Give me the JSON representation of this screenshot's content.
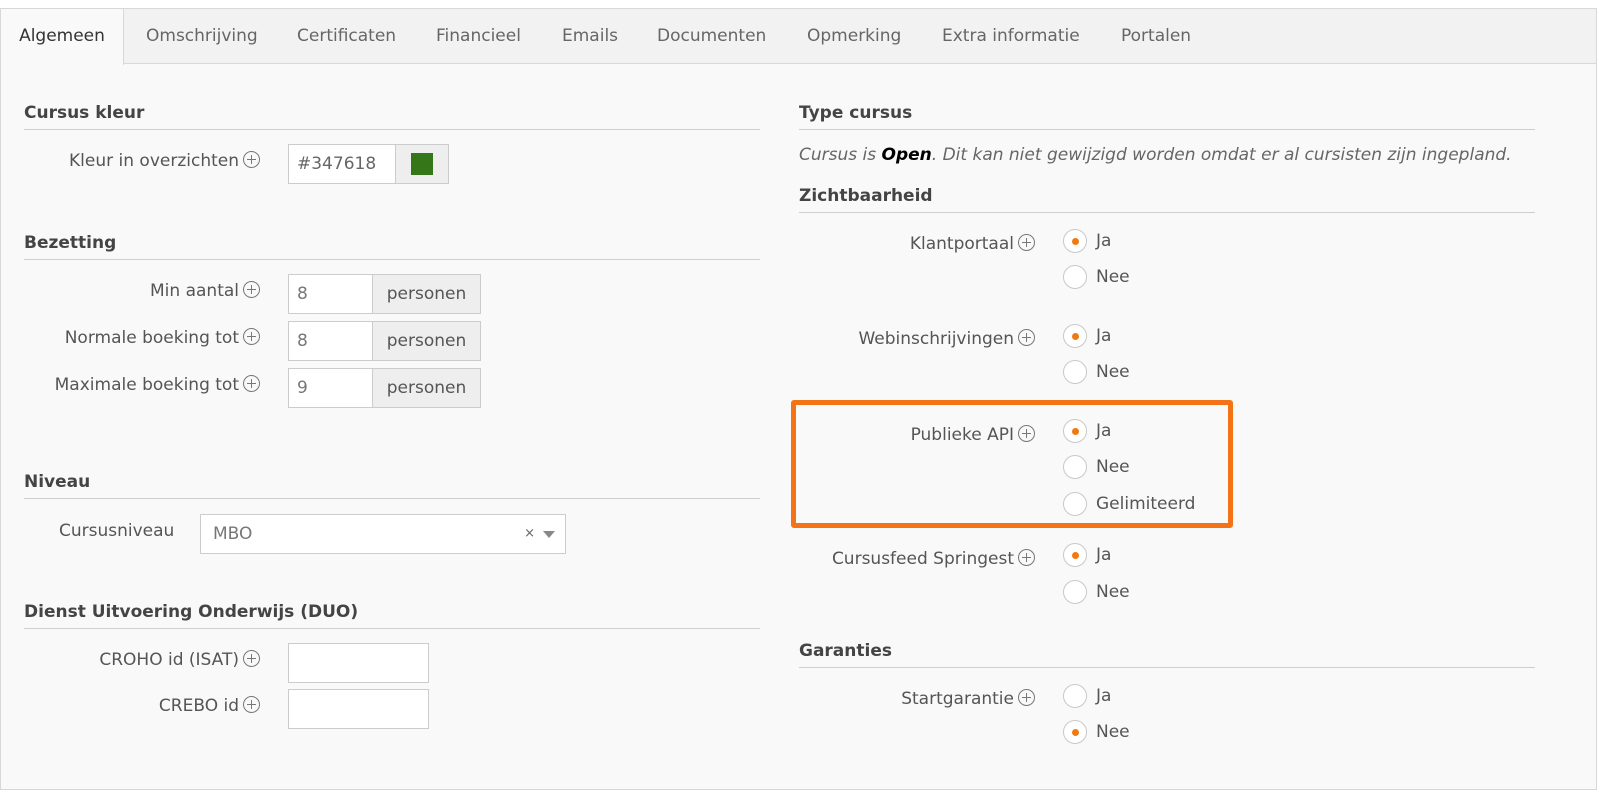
{
  "tabs": [
    "Algemeen",
    "Omschrijving",
    "Certificaten",
    "Financieel",
    "Emails",
    "Documenten",
    "Opmerking",
    "Extra informatie",
    "Portalen"
  ],
  "cursus_kleur": {
    "heading": "Cursus kleur",
    "label": "Kleur in overzichten",
    "value": "#347618",
    "swatch_color": "#347618"
  },
  "bezetting": {
    "heading": "Bezetting",
    "unit": "personen",
    "rows": [
      {
        "label": "Min aantal",
        "value": "8"
      },
      {
        "label": "Normale boeking tot",
        "value": "8"
      },
      {
        "label": "Maximale boeking tot",
        "value": "9"
      }
    ]
  },
  "niveau": {
    "heading": "Niveau",
    "label": "Cursusniveau",
    "selected": "MBO",
    "clear": "×"
  },
  "duo": {
    "heading": "Dienst Uitvoering Onderwijs (DUO)",
    "croho_label": "CROHO id (ISAT)",
    "croho_value": "",
    "crebo_label": "CREBO id",
    "crebo_value": ""
  },
  "type_cursus": {
    "heading": "Type cursus",
    "note_prefix": "Cursus is ",
    "note_bold": "Open",
    "note_suffix": ". Dit kan niet gewijzigd worden omdat er al cursisten zijn ingepland."
  },
  "zichtbaarheid": {
    "heading": "Zichtbaarheid",
    "klantportaal": {
      "label": "Klantportaal",
      "options": [
        "Ja",
        "Nee"
      ],
      "selected": "Ja"
    },
    "webinschrijvingen": {
      "label": "Webinschrijvingen",
      "options": [
        "Ja",
        "Nee"
      ],
      "selected": "Ja"
    },
    "publieke_api": {
      "label": "Publieke API",
      "options": [
        "Ja",
        "Nee",
        "Gelimiteerd"
      ],
      "selected": "Ja"
    },
    "springest": {
      "label": "Cursusfeed Springest",
      "options": [
        "Ja",
        "Nee"
      ],
      "selected": "Ja"
    }
  },
  "garanties": {
    "heading": "Garanties",
    "startgarantie": {
      "label": "Startgarantie",
      "options": [
        "Ja",
        "Nee"
      ],
      "selected": "Nee"
    }
  },
  "colors": {
    "accent": "#f07a10",
    "highlight": "#f57317"
  }
}
